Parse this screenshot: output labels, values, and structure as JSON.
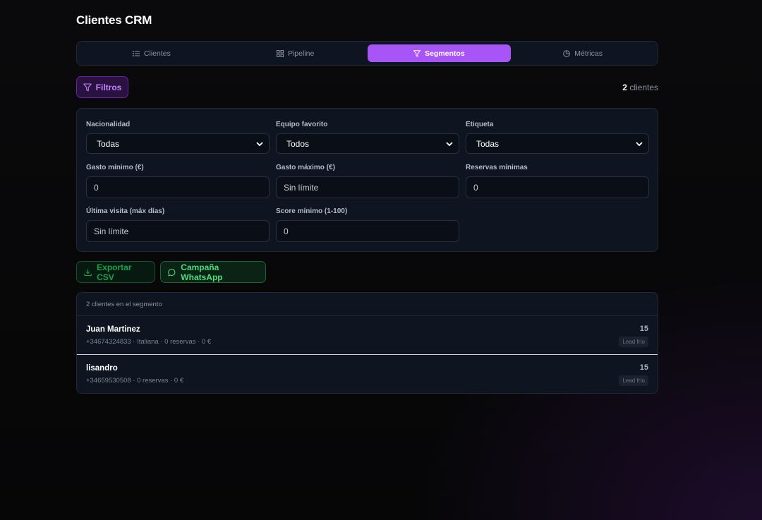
{
  "page": {
    "title": "Clientes CRM"
  },
  "tabs": [
    {
      "label": "Clientes",
      "icon": "list-icon"
    },
    {
      "label": "Pipeline",
      "icon": "grid-icon"
    },
    {
      "label": "Segmentos",
      "icon": "filter-icon",
      "active": true
    },
    {
      "label": "Métricas",
      "icon": "pie-chart-icon"
    }
  ],
  "toolbar": {
    "filters_label": "Filtros",
    "count_value": "2",
    "count_label": "clientes"
  },
  "filters": {
    "nationality": {
      "label": "Nacionalidad",
      "value": "Todas"
    },
    "team": {
      "label": "Equipo favorito",
      "value": "Todos"
    },
    "tag": {
      "label": "Etiqueta",
      "value": "Todas"
    },
    "min_spend": {
      "label": "Gasto mínimo (€)",
      "placeholder": "0"
    },
    "max_spend": {
      "label": "Gasto máximo (€)",
      "placeholder": "Sin límite"
    },
    "min_bookings": {
      "label": "Reservas mínimas",
      "placeholder": "0"
    },
    "last_visit": {
      "label": "Última visita (máx días)",
      "placeholder": "Sin límite"
    },
    "min_score": {
      "label": "Score mínimo (1-100)",
      "placeholder": "0"
    }
  },
  "actions": {
    "export_label": "Exportar CSV",
    "whatsapp_label": "Campaña WhatsApp"
  },
  "segment": {
    "header": "2 clientes en el segmento",
    "clients": [
      {
        "name": "Juan Martinez",
        "meta": "+34674324833 · Italiana · 0 reservas · 0 €",
        "score": "15",
        "tag": "Lead frío"
      },
      {
        "name": "lisandro",
        "meta": "+34659530508 · 0 reservas · 0 €",
        "score": "15",
        "tag": "Lead frío"
      }
    ]
  },
  "colors": {
    "accent": "#a855f7",
    "green": "#4ade80",
    "panel": "#0f1520"
  }
}
